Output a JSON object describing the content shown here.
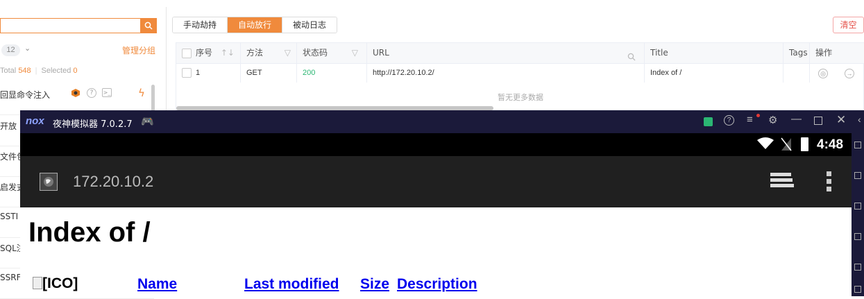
{
  "left_panel": {
    "count_badge": "12",
    "manage_label": "管理分组",
    "total_label": "Total",
    "total_value": "548",
    "selected_label": "Selected",
    "selected_value": "0",
    "items": [
      {
        "label": "回显命令注入"
      },
      {
        "label": "开放"
      },
      {
        "label": "文件包"
      },
      {
        "label": "启发式"
      },
      {
        "label": "SSTI E"
      },
      {
        "label": "SQL注"
      },
      {
        "label": "SSRF"
      }
    ]
  },
  "tabs": [
    {
      "label": "手动劫持"
    },
    {
      "label": "自动放行"
    },
    {
      "label": "被动日志"
    }
  ],
  "clear_label": "清空",
  "table": {
    "columns": [
      "序号",
      "方法",
      "状态码",
      "URL",
      "Title",
      "Tags",
      "操作"
    ],
    "rows": [
      {
        "index": "1",
        "method": "GET",
        "status": "200",
        "url": "http://172.20.10.2/",
        "title": "Index of /",
        "tags": ""
      }
    ],
    "no_more": "暂无更多数据"
  },
  "emulator": {
    "title": "夜神模拟器 7.0.2.7",
    "logo": "nox",
    "time": "4:48",
    "address": "172.20.10.2",
    "page_heading": "Index of /",
    "img_alt": "[ICO]",
    "col_name": "Name",
    "col_modified": "Last modified",
    "col_size": "Size",
    "col_description": "Description"
  },
  "colors": {
    "accent": "#f08a3c",
    "status_ok": "#2bb673",
    "emulator_frame": "#1b1a3a",
    "link": "#0000ee"
  }
}
